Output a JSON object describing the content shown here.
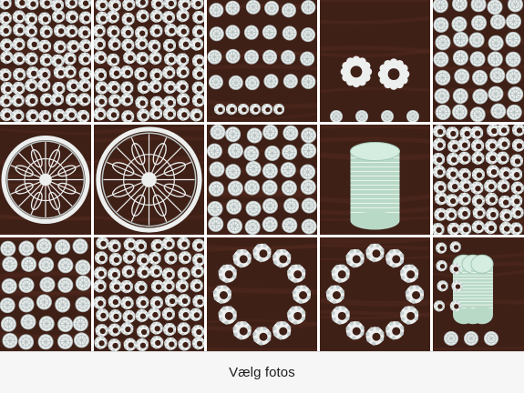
{
  "picker": {
    "title": "Vælg fotos"
  },
  "theme": {
    "wood": "#3f2017",
    "wood_light": "#5a2f20",
    "lace": "#ecefee",
    "lace_shadow": "#b9c4c4",
    "glass": "#b9d9c7",
    "bar_bg": "#f6f6f6"
  },
  "photos": [
    {
      "label": "photo-r1-c1",
      "kind": "arches"
    },
    {
      "label": "photo-r1-c2",
      "kind": "arches"
    },
    {
      "label": "photo-r1-c3",
      "kind": "mix"
    },
    {
      "label": "photo-r1-c4",
      "kind": "rings"
    },
    {
      "label": "photo-r1-c5",
      "kind": "rosettes"
    },
    {
      "label": "photo-r2-c1",
      "kind": "doily"
    },
    {
      "label": "photo-r2-c2",
      "kind": "doily"
    },
    {
      "label": "photo-r2-c3",
      "kind": "rosettes"
    },
    {
      "label": "photo-r2-c4",
      "kind": "stack"
    },
    {
      "label": "photo-r2-c5",
      "kind": "arches"
    },
    {
      "label": "photo-r3-c1",
      "kind": "rosettes"
    },
    {
      "label": "photo-r3-c2",
      "kind": "arches"
    },
    {
      "label": "photo-r3-c3",
      "kind": "circle"
    },
    {
      "label": "photo-r3-c4",
      "kind": "circle"
    },
    {
      "label": "photo-r3-c5",
      "kind": "stacks"
    }
  ]
}
